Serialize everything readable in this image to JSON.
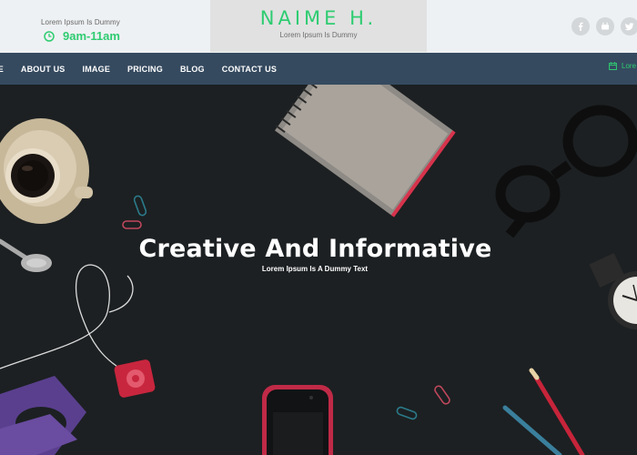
{
  "header": {
    "hours_label": "Lorem Ipsum Is Dummy",
    "hours_time": "9am-11am",
    "logo_title": "NAIME H.",
    "logo_subtitle": "Lorem Ipsum Is Dummy",
    "socials": [
      "facebook-icon",
      "youtube-icon",
      "twitter-icon"
    ]
  },
  "nav": {
    "items": [
      "ME",
      "ABOUT US",
      "IMAGE",
      "PRICING",
      "BLOG",
      "CONTACT US"
    ],
    "right_text": "Lore"
  },
  "hero": {
    "title": "Creative And Informative",
    "subtitle": "Lorem Ipsum Is A Dummy Text"
  },
  "colors": {
    "accent": "#2ecc71",
    "nav_bg": "#354a5f",
    "hero_bg": "#1c2022"
  }
}
